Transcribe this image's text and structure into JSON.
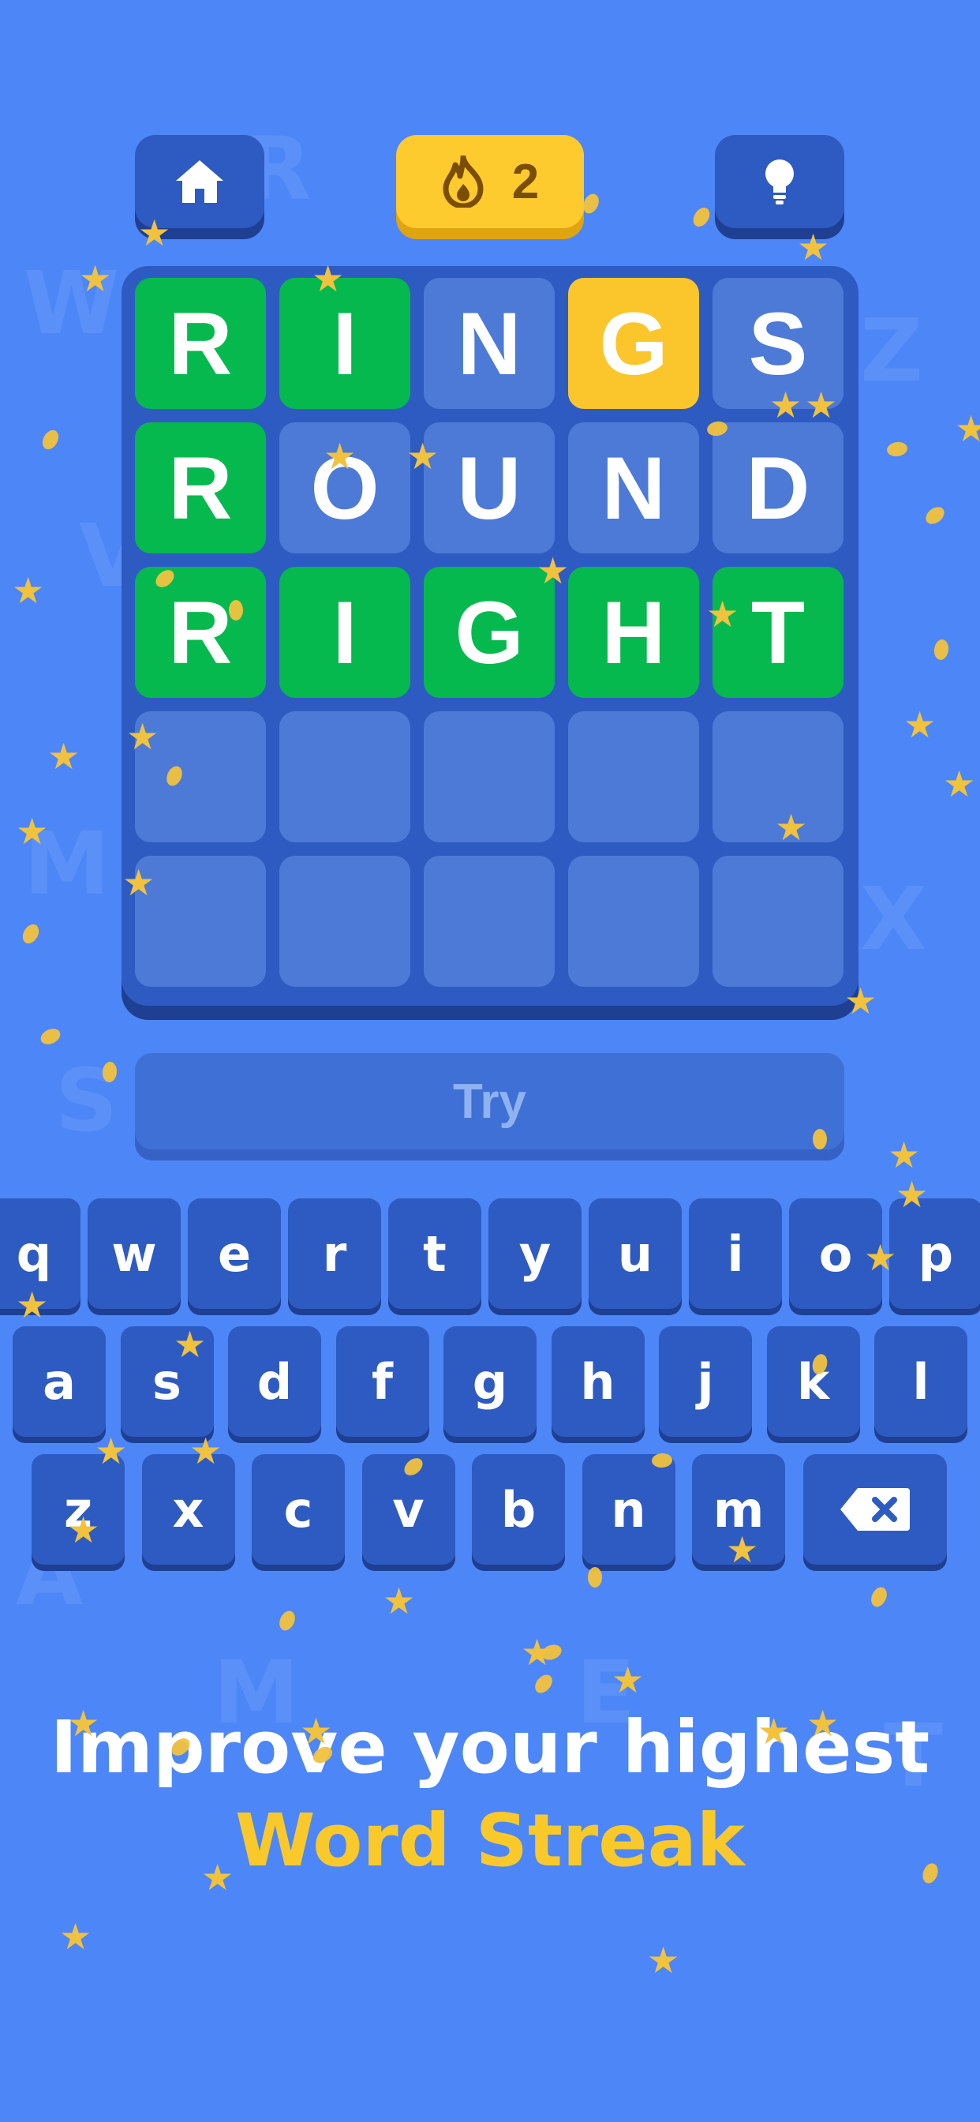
{
  "top_bar": {
    "home_icon": "home-icon",
    "streak_icon": "flame-icon",
    "streak_count": "2",
    "hint_icon": "lightbulb-icon"
  },
  "board": {
    "rows": [
      [
        {
          "letter": "R",
          "state": "correct"
        },
        {
          "letter": "I",
          "state": "correct"
        },
        {
          "letter": "N",
          "state": "absent"
        },
        {
          "letter": "G",
          "state": "present"
        },
        {
          "letter": "S",
          "state": "absent"
        }
      ],
      [
        {
          "letter": "R",
          "state": "correct"
        },
        {
          "letter": "O",
          "state": "absent"
        },
        {
          "letter": "U",
          "state": "absent"
        },
        {
          "letter": "N",
          "state": "absent"
        },
        {
          "letter": "D",
          "state": "absent"
        }
      ],
      [
        {
          "letter": "R",
          "state": "correct"
        },
        {
          "letter": "I",
          "state": "correct"
        },
        {
          "letter": "G",
          "state": "correct"
        },
        {
          "letter": "H",
          "state": "correct"
        },
        {
          "letter": "T",
          "state": "correct"
        }
      ],
      [
        {
          "letter": "",
          "state": "empty"
        },
        {
          "letter": "",
          "state": "empty"
        },
        {
          "letter": "",
          "state": "empty"
        },
        {
          "letter": "",
          "state": "empty"
        },
        {
          "letter": "",
          "state": "empty"
        }
      ],
      [
        {
          "letter": "",
          "state": "empty"
        },
        {
          "letter": "",
          "state": "empty"
        },
        {
          "letter": "",
          "state": "empty"
        },
        {
          "letter": "",
          "state": "empty"
        },
        {
          "letter": "",
          "state": "empty"
        }
      ]
    ]
  },
  "try_button": {
    "label": "Try"
  },
  "keyboard": {
    "row1": [
      "q",
      "w",
      "e",
      "r",
      "t",
      "y",
      "u",
      "i",
      "o",
      "p"
    ],
    "row2": [
      "a",
      "s",
      "d",
      "f",
      "g",
      "h",
      "j",
      "k",
      "l"
    ],
    "row3": [
      "z",
      "x",
      "c",
      "v",
      "b",
      "n",
      "m"
    ],
    "backspace_icon": "backspace-icon"
  },
  "promo": {
    "line1": "Improve your highest",
    "line2": "Word Streak"
  },
  "colors": {
    "background": "#4d86f6",
    "correct": "#05b94f",
    "present": "#fbc62c",
    "tile_empty": "#4c7ad6",
    "key": "#2e5bc1",
    "accent_text": "#f9c92b"
  }
}
